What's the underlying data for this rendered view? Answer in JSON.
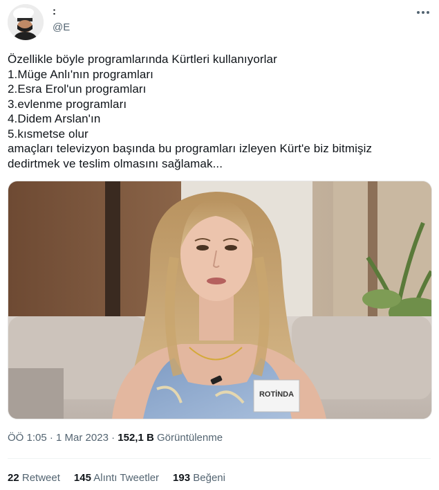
{
  "author": {
    "name": ":",
    "handle": "@E"
  },
  "tweet": {
    "lines": [
      "Özellikle böyle programlarında Kürtleri kullanıyorlar",
      "1.Müge Anlı'nın programları",
      "2.Esra Erol'un programları",
      "3.evlenme programları",
      "4.Didem Arslan'ın",
      "5.kısmetse olur",
      "amaçları televizyon başında bu programları izleyen Kürt'e biz bitmişiz",
      "dedirtmek ve teslim olmasını sağlamak..."
    ],
    "photo_badge": "ROTİNDA"
  },
  "meta": {
    "time": "ÖÖ 1:05",
    "separator": "·",
    "date": "1 Mar 2023",
    "views": "152,1 B",
    "views_label": "Görüntülenme"
  },
  "stats": {
    "retweets": "22",
    "retweets_label": "Retweet",
    "quotes": "145",
    "quotes_label": "Alıntı Tweetler",
    "likes": "193",
    "likes_label": "Beğeni"
  },
  "icons": {
    "more": "more-horizontal-icon"
  }
}
